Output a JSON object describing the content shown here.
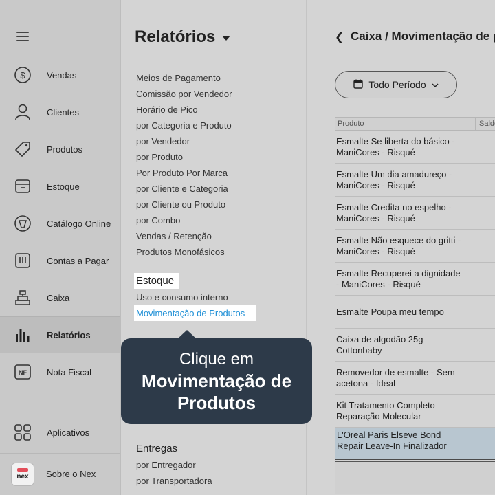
{
  "sidebar": {
    "items": [
      {
        "label": "Vendas",
        "icon": "dollar-circle-icon"
      },
      {
        "label": "Clientes",
        "icon": "user-icon"
      },
      {
        "label": "Produtos",
        "icon": "tag-icon"
      },
      {
        "label": "Estoque",
        "icon": "box-icon"
      },
      {
        "label": "Catálogo Online",
        "icon": "catalog-icon"
      },
      {
        "label": "Contas a Pagar",
        "icon": "invoice-icon"
      },
      {
        "label": "Caixa",
        "icon": "cash-register-icon"
      },
      {
        "label": "Relatórios",
        "icon": "bar-chart-icon"
      },
      {
        "label": "Nota Fiscal",
        "icon": "nf-icon",
        "icon_text": "NF"
      }
    ],
    "apps_label": "Aplicativos",
    "about_label": "Sobre o Nex",
    "logo_text": "nex"
  },
  "reports": {
    "title": "Relatórios",
    "links": [
      "Meios de Pagamento",
      "Comissão por Vendedor",
      "Horário de Pico",
      "por Categoria e Produto",
      "por Vendedor",
      "por Produto",
      "Por Produto Por Marca",
      "por Cliente e Categoria",
      "por Cliente ou Produto",
      "por Combo",
      "Vendas / Retenção",
      "Produtos Monofásicos"
    ],
    "estoque_section": "Estoque",
    "estoque_links": [
      "Uso e consumo interno",
      "Movimentação de Produtos"
    ],
    "entregas_section": "Entregas",
    "entregas_links": [
      "por Entregador",
      "por Transportadora"
    ]
  },
  "content": {
    "breadcrumb": "Caixa / Movimentação de pr",
    "period_label": "Todo Período",
    "table": {
      "headers": [
        "Produto",
        "Saldo"
      ],
      "rows": [
        [
          "Esmalte Se liberta do básico -",
          "ManiCores - Risqué"
        ],
        [
          "Esmalte Um dia amadureço -",
          "ManiCores - Risqué"
        ],
        [
          "Esmalte Credita no espelho -",
          "ManiCores - Risqué"
        ],
        [
          "Esmalte Não esquece do gritti -",
          "ManiCores - Risqué"
        ],
        [
          "Esmalte Recuperei a dignidade",
          "- ManiCores - Risqué"
        ],
        [
          "Esmalte Poupa meu tempo"
        ],
        [
          "Caixa de algodão 25g",
          "Cottonbaby"
        ],
        [
          "Removedor de esmalte - Sem",
          "acetona - Ideal"
        ],
        [
          "Kit Tratamento Completo",
          "Reparação Molecular"
        ],
        [
          "L'Oreal Paris Elseve Bond",
          "Repair Leave-In Finalizador"
        ]
      ]
    }
  },
  "tooltip": {
    "line1": "Clique em",
    "line2": "Movimentação de",
    "line3": "Produtos"
  },
  "colors": {
    "tooltip_bg": "#2d3a49",
    "link_highlight": "#1e8fd6",
    "selected_row": "#b8c6d0",
    "brand_red": "#e34e5a"
  }
}
